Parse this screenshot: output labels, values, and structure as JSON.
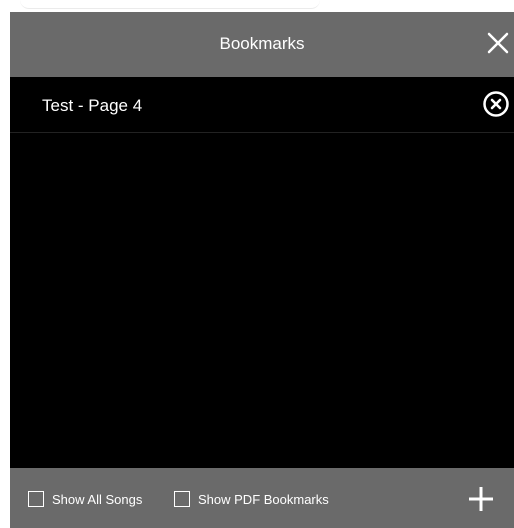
{
  "dialog": {
    "title": "Bookmarks",
    "close_icon": "close-icon"
  },
  "bookmarks": [
    {
      "label": "Test - Page 4",
      "remove_icon": "remove-circle-icon"
    }
  ],
  "footer": {
    "show_all_songs": {
      "label": "Show All Songs",
      "checked": false
    },
    "show_pdf_bookmarks": {
      "label": "Show PDF Bookmarks",
      "checked": false
    },
    "add_icon": "plus-icon"
  },
  "colors": {
    "header_bg": "#6a6a6a",
    "list_bg": "#000000",
    "text": "#ffffff"
  }
}
